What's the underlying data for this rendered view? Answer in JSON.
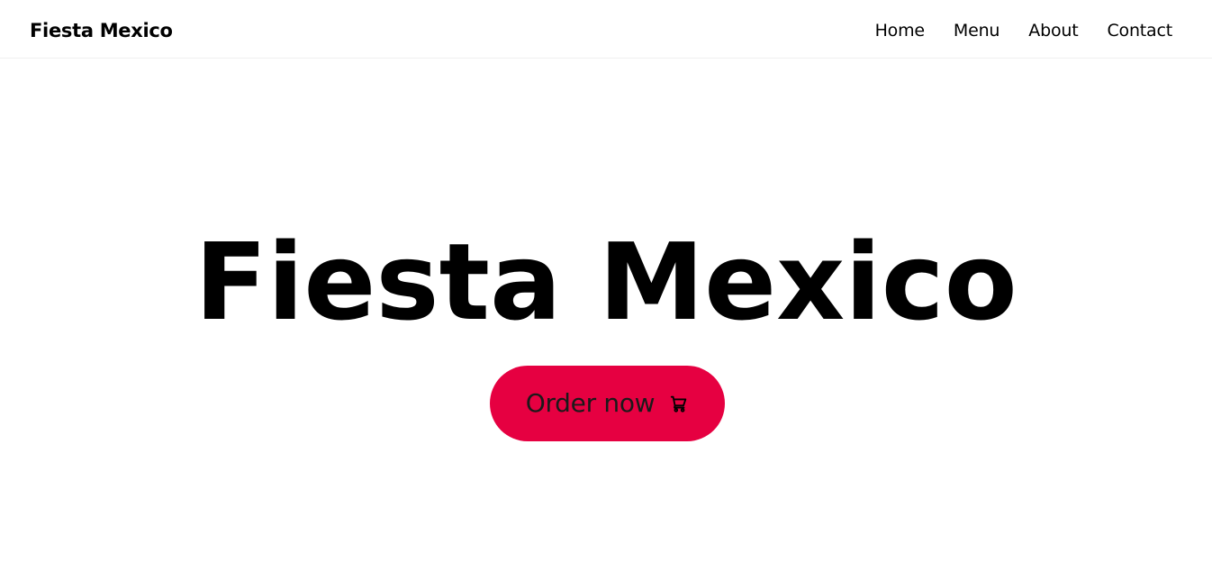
{
  "header": {
    "brand": "Fiesta Mexico",
    "nav": [
      {
        "label": "Home"
      },
      {
        "label": "Menu"
      },
      {
        "label": "About"
      },
      {
        "label": "Contact"
      }
    ]
  },
  "hero": {
    "title": "Fiesta Mexico",
    "cta_label": "Order now",
    "cta_icon": "shopping-cart-icon"
  },
  "colors": {
    "accent": "#e60041",
    "background": "#ffffff",
    "text": "#000000"
  }
}
